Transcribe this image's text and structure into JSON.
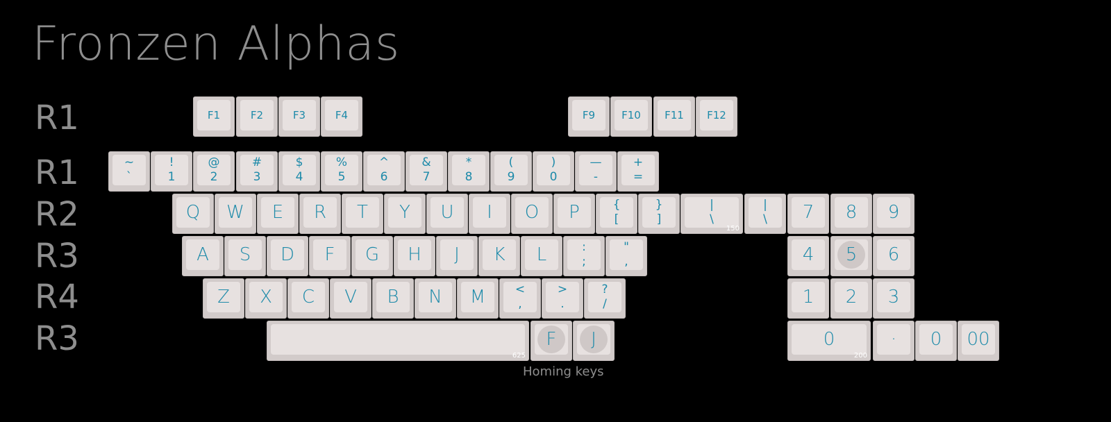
{
  "title": "Fronzen Alphas",
  "row_labels": [
    "R1",
    "R1",
    "R2",
    "R3",
    "R4",
    "R3"
  ],
  "fn_row": {
    "left": [
      "F1",
      "F2",
      "F3",
      "F4"
    ],
    "right": [
      "F9",
      "F10",
      "F11",
      "F12"
    ]
  },
  "number_row": [
    {
      "top": "~",
      "bottom": "`"
    },
    {
      "top": "!",
      "bottom": "1"
    },
    {
      "top": "@",
      "bottom": "2"
    },
    {
      "top": "#",
      "bottom": "3"
    },
    {
      "top": "$",
      "bottom": "4"
    },
    {
      "top": "%",
      "bottom": "5"
    },
    {
      "top": "^",
      "bottom": "6"
    },
    {
      "top": "&",
      "bottom": "7"
    },
    {
      "top": "*",
      "bottom": "8"
    },
    {
      "top": "(",
      "bottom": "9"
    },
    {
      "top": ")",
      "bottom": "0"
    },
    {
      "top": "—",
      "bottom": "-"
    },
    {
      "top": "+",
      "bottom": "="
    }
  ],
  "qwerty_row": {
    "letters": [
      "Q",
      "W",
      "E",
      "R",
      "T",
      "Y",
      "U",
      "I",
      "O",
      "P"
    ],
    "brackets": [
      {
        "top": "{",
        "bottom": "["
      },
      {
        "top": "}",
        "bottom": "]"
      }
    ],
    "backslash_wide": {
      "top": "|",
      "bottom": "\\",
      "size": "150"
    },
    "backslash": {
      "top": "|",
      "bottom": "\\"
    }
  },
  "home_row": {
    "letters": [
      "A",
      "S",
      "D",
      "F",
      "G",
      "H",
      "J",
      "K",
      "L"
    ],
    "punct": [
      {
        "top": ":",
        "bottom": ";"
      },
      {
        "top": "\"",
        "bottom": ","
      }
    ]
  },
  "bottom_row": {
    "letters": [
      "Z",
      "X",
      "C",
      "V",
      "B",
      "N",
      "M"
    ],
    "punct": [
      {
        "top": "<",
        "bottom": ","
      },
      {
        "top": ">",
        "bottom": "."
      },
      {
        "top": "?",
        "bottom": "/"
      }
    ]
  },
  "space_row": {
    "spacebar_size": "625",
    "homing": [
      "F",
      "J"
    ],
    "homing_label": "Homing keys"
  },
  "numpad": {
    "row1": [
      "7",
      "8",
      "9"
    ],
    "row2": [
      "4",
      "5",
      "6"
    ],
    "row3": [
      "1",
      "2",
      "3"
    ],
    "zero": {
      "label": "0",
      "size": "200"
    },
    "row4_rest": [
      "·",
      "0",
      "00"
    ]
  },
  "colors": {
    "background": "#000000",
    "legend": "#1d8aa9",
    "keycap": "#e7e1e0",
    "label": "#8e8e8e"
  }
}
